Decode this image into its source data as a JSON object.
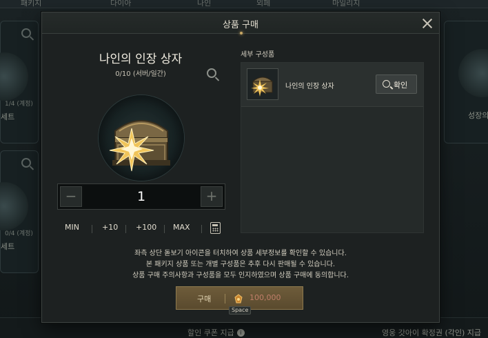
{
  "background": {
    "tabs": [
      "패키지",
      "다이아",
      "나인",
      "외페",
      "마일리지"
    ],
    "cards": [
      {
        "count": "1/4 (계정)",
        "label": "세트"
      },
      {
        "count": "0/4 (계정)",
        "label": "세트"
      },
      {
        "label": "성장의"
      }
    ],
    "bottom": {
      "coupon_text": "할인 쿠폰 지급",
      "voucher_text": "영웅 갓아이 확정권 (각인) 지급"
    }
  },
  "modal": {
    "title": "상품 구매",
    "product": {
      "name": "나인의 인장 상자",
      "limit": "0/10 (서버/일간)",
      "image_icon": "treasure-chest-icon"
    },
    "quantity": {
      "value": "1",
      "minus_symbol": "−",
      "plus_symbol": "+"
    },
    "quantity_actions": {
      "min": "MIN",
      "plus10": "+10",
      "plus100": "+100",
      "max": "MAX",
      "calculator_icon": "calculator-icon"
    },
    "details": {
      "label": "세부 구성품",
      "items": [
        {
          "name": "나인의 인장 상자",
          "button_label": "확인",
          "icon": "chest-thumb-icon"
        }
      ]
    },
    "notice": [
      "좌측 상단 돋보기 아이콘을 터치하여 상품 세부정보를 확인할 수 있습니다.",
      "본 패키지 상품 또는 개별 구성품은 추후 다시 판매될 수 있습니다.",
      "상품 구매 주의사항과 구성품을 모두 인지하였으며 상품 구매에 동의합니다."
    ],
    "buy": {
      "label": "구매",
      "price": "100,000",
      "currency_icon": "mileage-coin-icon",
      "hotkey": "Space"
    }
  },
  "colors": {
    "accent_gold": "#c9a865",
    "buy_button": "#6e5c3a",
    "price_text": "#c07f6a"
  }
}
